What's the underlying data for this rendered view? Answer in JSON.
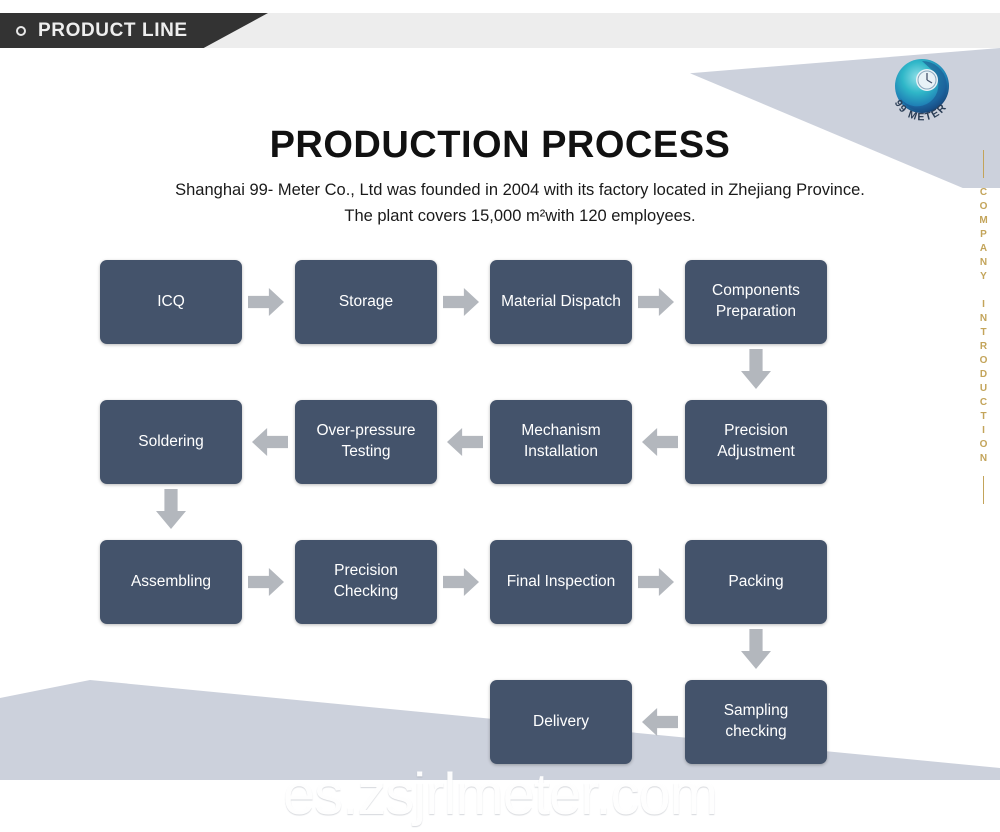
{
  "topbar": {
    "bullet_icon": "circle-outline-icon",
    "label": "PRODUCT LINE"
  },
  "logo": {
    "icon": "99-meter-swirl-logo",
    "brand": "99 METER",
    "colors": {
      "outer": "#1f7fb5",
      "mid": "#2fb7c8",
      "inner": "#1a4f8a",
      "dial": "#e8f2f7"
    }
  },
  "side_label": {
    "text": "COMPANY INTRODUCTION",
    "color": "#c3a45a"
  },
  "heading": {
    "title": "PRODUCTION PROCESS",
    "description": "Shanghai 99- Meter Co., Ltd was founded in 2004 with its factory located in Zhejiang Province. The plant covers 15,000 m²with 120 employees."
  },
  "theme": {
    "node_fill": "#44536b",
    "node_text": "#ffffff",
    "arrow_fill": "#b3b7bd",
    "wedge_fill": "#ccd1dc",
    "banner_dark": "#333333",
    "banner_light": "#ededed"
  },
  "flow": {
    "rows": [
      {
        "direction": "left-to-right",
        "nodes": [
          "ICQ",
          "Storage",
          "Material Dispatch",
          "Components Preparation"
        ]
      },
      {
        "direction": "right-to-left",
        "nodes": [
          "Soldering",
          "Over-pressure Testing",
          "Mechanism Installation",
          "Precision Adjustment"
        ]
      },
      {
        "direction": "left-to-right",
        "nodes": [
          "Assembling",
          "Precision Checking",
          "Final Inspection",
          "Packing"
        ]
      },
      {
        "direction": "right-to-left",
        "nodes": [
          "Delivery",
          "Sampling checking"
        ]
      }
    ],
    "connector_arrows": {
      "right": "arrow-right-icon",
      "left": "arrow-left-icon",
      "down": "arrow-down-icon"
    }
  },
  "watermark": {
    "text": "es.zsjrlmeter.com"
  }
}
